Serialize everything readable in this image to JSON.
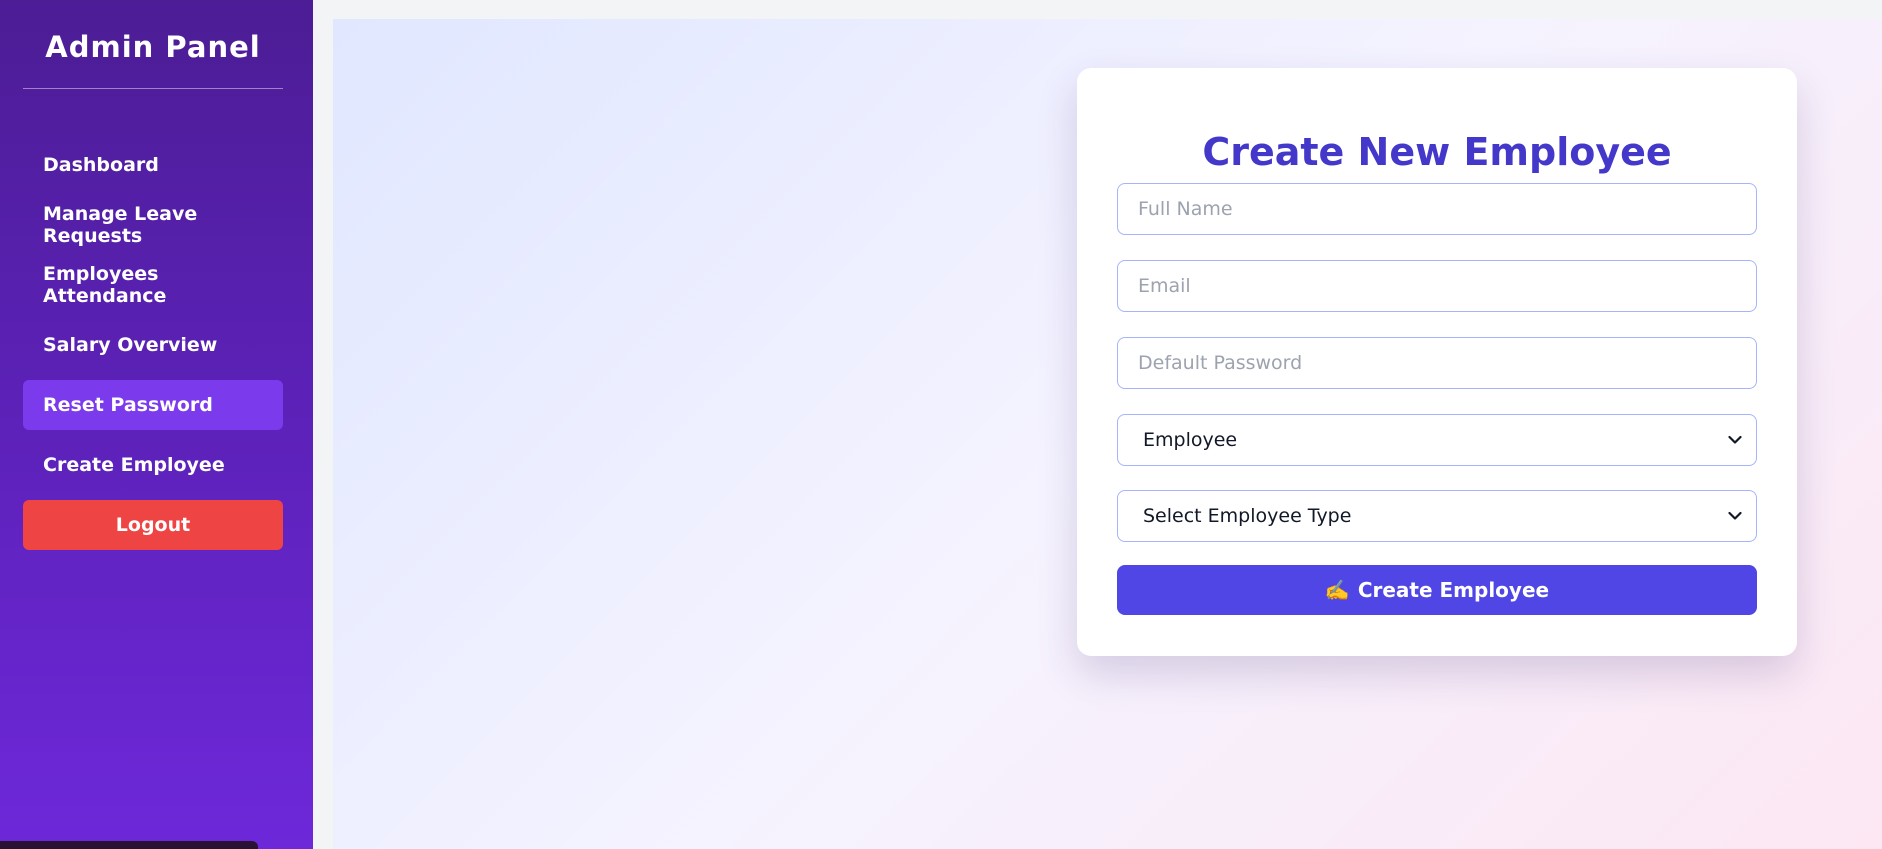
{
  "sidebar": {
    "title": "Admin Panel",
    "items": [
      {
        "label": "Dashboard"
      },
      {
        "label": "Manage Leave Requests"
      },
      {
        "label": "Employees Attendance"
      },
      {
        "label": "Salary Overview"
      },
      {
        "label": "Reset Password"
      },
      {
        "label": "Create Employee"
      }
    ],
    "active_item": "Reset Password",
    "logout_label": "Logout"
  },
  "form": {
    "title": "Create New Employee",
    "full_name": {
      "placeholder": "Full Name",
      "value": ""
    },
    "email": {
      "placeholder": "Email",
      "value": ""
    },
    "password": {
      "placeholder": "Default Password",
      "value": ""
    },
    "role_select": {
      "selected": "Employee"
    },
    "type_select": {
      "selected": "Select Employee Type"
    },
    "submit": {
      "icon": "✍️",
      "icon_name": "writing-hand-icon",
      "label": "Create Employee"
    }
  },
  "colors": {
    "sidebar_top": "#4c1d95",
    "sidebar_bottom": "#6d28d9",
    "active_item": "#7c3aed",
    "logout": "#ef4444",
    "title": "#4338ca",
    "submit": "#4f46e5",
    "input_border": "#a5b4fc"
  }
}
